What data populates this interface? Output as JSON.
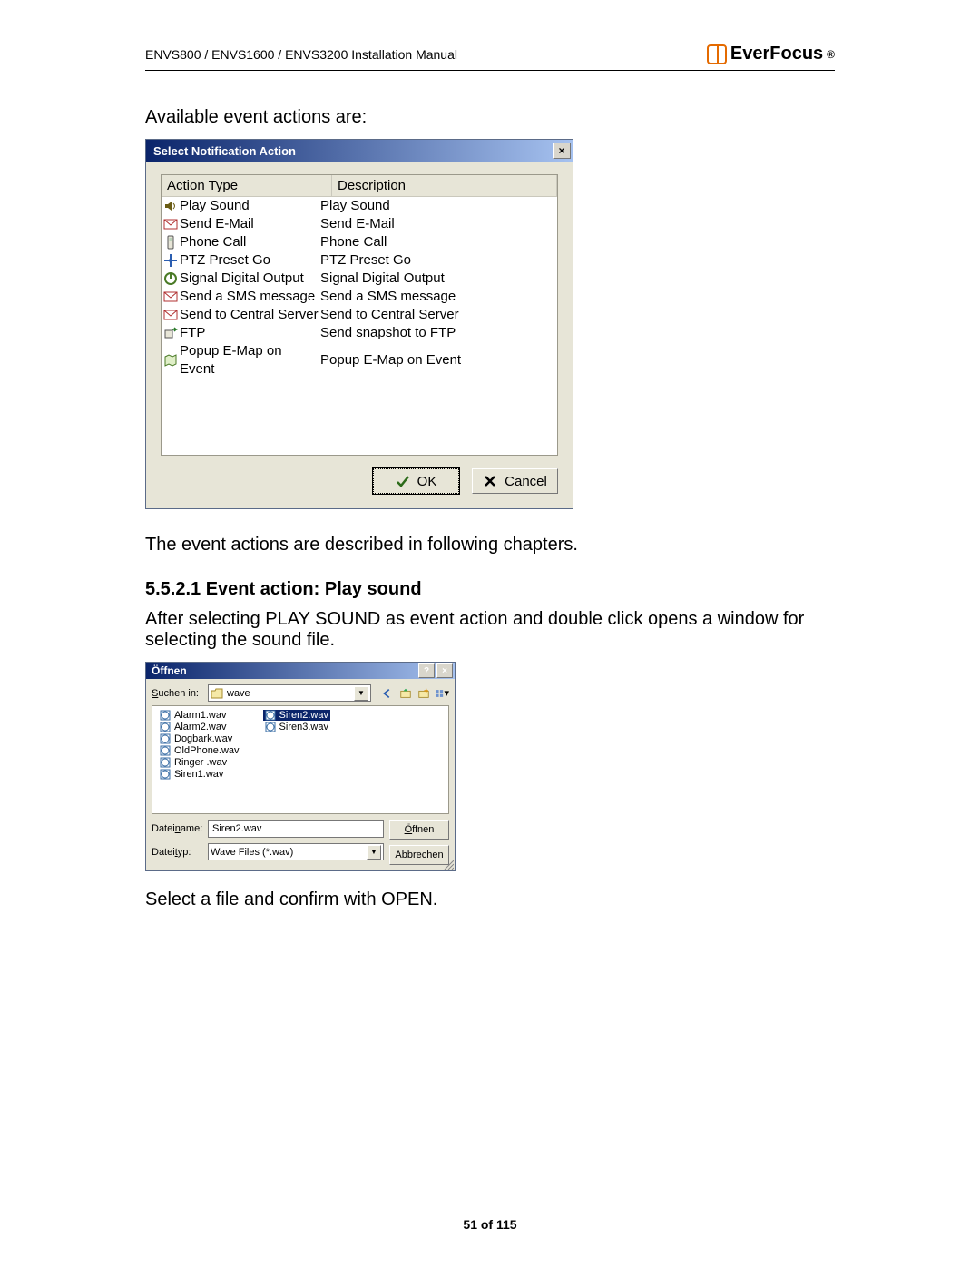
{
  "header": {
    "left": "ENVS800 / ENVS1600 / ENVS3200 Installation Manual",
    "brand": "EverFocus",
    "reg": "®"
  },
  "intro1": "Available event actions are:",
  "dlg1": {
    "title": "Select Notification Action",
    "col_a": "Action Type",
    "col_b": "Description",
    "rows": [
      {
        "a": "Play Sound",
        "b": "Play Sound",
        "icon": "speaker-icon"
      },
      {
        "a": "Send E-Mail",
        "b": "Send E-Mail",
        "icon": "mail-icon"
      },
      {
        "a": "Phone Call",
        "b": "Phone Call",
        "icon": "phone-icon"
      },
      {
        "a": "PTZ Preset Go",
        "b": "PTZ Preset Go",
        "icon": "ptz-icon"
      },
      {
        "a": "Signal Digital Output",
        "b": "Signal Digital Output",
        "icon": "output-icon"
      },
      {
        "a": "Send a SMS message",
        "b": "Send a SMS message",
        "icon": "mail-icon"
      },
      {
        "a": "Send to Central Server",
        "b": "Send to Central Server",
        "icon": "mail-icon"
      },
      {
        "a": "FTP",
        "b": "Send snapshot to FTP",
        "icon": "ftp-icon"
      },
      {
        "a": "Popup E-Map on Event",
        "b": "Popup E-Map on Event",
        "icon": "map-icon"
      }
    ],
    "ok": "OK",
    "cancel": "Cancel"
  },
  "para2": "The event actions are described in following chapters.",
  "section": "5.5.2.1   Event action: Play sound",
  "para3": "After selecting PLAY SOUND as event action and double click opens a window for selecting the sound file.",
  "dlg2": {
    "title": "Öffnen",
    "help": "?",
    "close": "×",
    "suchen": "Suchen in:",
    "folder": "wave",
    "files_col1": [
      "Alarm1.wav",
      "Alarm2.wav",
      "Dogbark.wav",
      "OldPhone.wav",
      "Ringer .wav",
      "Siren1.wav"
    ],
    "files_col2": [
      "Siren2.wav",
      "Siren3.wav"
    ],
    "selected": "Siren2.wav",
    "name_label": "Dateiname:",
    "name_value": "Siren2.wav",
    "type_label": "Dateityp:",
    "type_value": "Wave Files (*.wav)",
    "open": "Öffnen",
    "cancel": "Abbrechen"
  },
  "para4": "Select a file and confirm with OPEN.",
  "footer": "51 of 115"
}
